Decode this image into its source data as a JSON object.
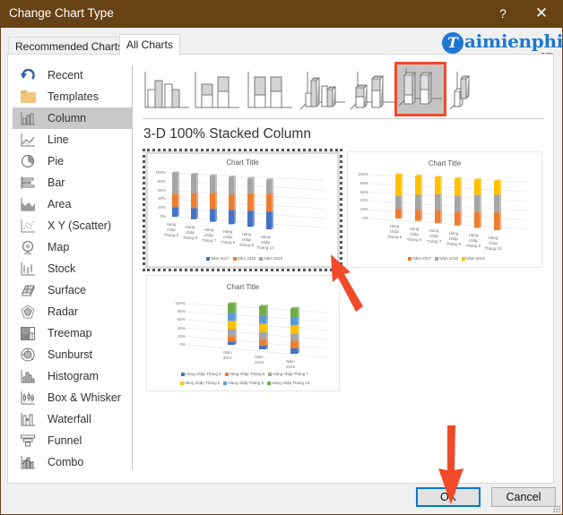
{
  "window": {
    "title": "Change Chart Type",
    "help_label": "?",
    "close_label": "✕"
  },
  "watermark": {
    "initial": "T",
    "text": "aimienphi",
    "suffix": ".vn"
  },
  "tabs": [
    {
      "label": "Recommended Charts",
      "active": false
    },
    {
      "label": "All Charts",
      "active": true
    }
  ],
  "sidebar": {
    "selected": "Column",
    "items": [
      {
        "label": "Recent",
        "icon": "recent-icon"
      },
      {
        "label": "Templates",
        "icon": "folder-icon"
      },
      {
        "label": "Column",
        "icon": "column-chart-icon"
      },
      {
        "label": "Line",
        "icon": "line-chart-icon"
      },
      {
        "label": "Pie",
        "icon": "pie-chart-icon"
      },
      {
        "label": "Bar",
        "icon": "bar-chart-icon"
      },
      {
        "label": "Area",
        "icon": "area-chart-icon"
      },
      {
        "label": "X Y (Scatter)",
        "icon": "scatter-chart-icon"
      },
      {
        "label": "Map",
        "icon": "map-chart-icon"
      },
      {
        "label": "Stock",
        "icon": "stock-chart-icon"
      },
      {
        "label": "Surface",
        "icon": "surface-chart-icon"
      },
      {
        "label": "Radar",
        "icon": "radar-chart-icon"
      },
      {
        "label": "Treemap",
        "icon": "treemap-chart-icon"
      },
      {
        "label": "Sunburst",
        "icon": "sunburst-chart-icon"
      },
      {
        "label": "Histogram",
        "icon": "histogram-chart-icon"
      },
      {
        "label": "Box & Whisker",
        "icon": "box-whisker-chart-icon"
      },
      {
        "label": "Waterfall",
        "icon": "waterfall-chart-icon"
      },
      {
        "label": "Funnel",
        "icon": "funnel-chart-icon"
      },
      {
        "label": "Combo",
        "icon": "combo-chart-icon"
      }
    ]
  },
  "subtypes": {
    "selected_index": 5,
    "selected_name": "3-D 100% Stacked Column",
    "items": [
      {
        "name": "Clustered Column",
        "icon": "clustered-column-icon"
      },
      {
        "name": "Stacked Column",
        "icon": "stacked-column-icon"
      },
      {
        "name": "100% Stacked Column",
        "icon": "100-stacked-column-icon"
      },
      {
        "name": "3-D Clustered Column",
        "icon": "3d-clustered-column-icon"
      },
      {
        "name": "3-D Stacked Column",
        "icon": "3d-stacked-column-icon"
      },
      {
        "name": "3-D 100% Stacked Column",
        "icon": "3d-100-stacked-column-icon"
      },
      {
        "name": "3-D Column",
        "icon": "3d-column-icon"
      }
    ]
  },
  "previews": [
    {
      "title": "Chart Title",
      "yticks": [
        "100%",
        "80%",
        "60%",
        "40%",
        "20%",
        "0%"
      ],
      "categories": [
        "Hàng nhập Tháng 5",
        "Hàng nhập Tháng 6",
        "Hàng nhập Tháng 7",
        "Hàng nhập Tháng 8",
        "Hàng nhập Tháng 9",
        "Hàng nhập Tháng 10"
      ],
      "series": [
        {
          "name": "Năm 2017",
          "color": "#4472c4",
          "values": [
            22,
            25,
            28,
            30,
            33,
            36
          ]
        },
        {
          "name": "Năm 2018",
          "color": "#ed7d31",
          "values": [
            30,
            33,
            35,
            33,
            36,
            36
          ]
        },
        {
          "name": "Năm 2019",
          "color": "#a5a5a5",
          "values": [
            48,
            42,
            37,
            37,
            31,
            28
          ]
        }
      ]
    },
    {
      "title": "Chart Title",
      "yticks": [
        "100%",
        "80%",
        "60%",
        "40%",
        "20%",
        "0%"
      ],
      "categories": [
        "Hàng nhập Tháng 5",
        "Hàng nhập Tháng 6",
        "Hàng nhập Tháng 7",
        "Hàng nhập Tháng 8",
        "Hàng nhập Tháng 9",
        "Hàng nhập Tháng 10"
      ],
      "series": [
        {
          "name": "Năm 2017",
          "color": "#ed7d31",
          "values": [
            22,
            25,
            28,
            30,
            33,
            36
          ]
        },
        {
          "name": "Năm 2018",
          "color": "#a5a5a5",
          "values": [
            30,
            33,
            35,
            33,
            36,
            36
          ]
        },
        {
          "name": "Năm 2019",
          "color": "#ffc000",
          "values": [
            48,
            42,
            37,
            37,
            31,
            28
          ]
        }
      ]
    },
    {
      "title": "Chart Title",
      "yticks": [
        "100%",
        "80%",
        "60%",
        "40%",
        "20%",
        "0%"
      ],
      "categories": [
        "Năm 2017",
        "Năm 2018",
        "Năm 2019"
      ],
      "series": [
        {
          "name": "Hàng nhập Tháng 5",
          "color": "#4472c4",
          "values": [
            8,
            9,
            12
          ]
        },
        {
          "name": "Hàng nhập Tháng 6",
          "color": "#ed7d31",
          "values": [
            13,
            15,
            17
          ]
        },
        {
          "name": "Hàng nhập Tháng 7",
          "color": "#a5a5a5",
          "values": [
            17,
            16,
            16
          ]
        },
        {
          "name": "Hàng nhập Tháng 8",
          "color": "#ffc000",
          "values": [
            20,
            19,
            18
          ]
        },
        {
          "name": "Hàng nhập Tháng 9",
          "color": "#5b9bd5",
          "values": [
            20,
            20,
            18
          ]
        },
        {
          "name": "Hàng nhập Tháng 10",
          "color": "#70ad47",
          "values": [
            22,
            21,
            19
          ]
        }
      ]
    }
  ],
  "buttons": {
    "ok": "OK",
    "cancel": "Cancel"
  },
  "annotations": {
    "arrow_color": "#f04a2a"
  }
}
